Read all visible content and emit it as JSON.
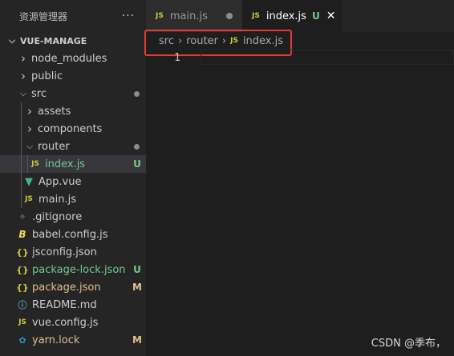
{
  "sidebar": {
    "title": "资源管理器",
    "more": "···",
    "project": "VUE-MANAGE",
    "items": [
      {
        "label": "node_modules",
        "kind": "folder",
        "expanded": false,
        "depth": 1
      },
      {
        "label": "public",
        "kind": "folder",
        "expanded": false,
        "depth": 1
      },
      {
        "label": "src",
        "kind": "folder",
        "expanded": true,
        "depth": 1,
        "status": "dot"
      },
      {
        "label": "assets",
        "kind": "folder",
        "expanded": false,
        "depth": 2
      },
      {
        "label": "components",
        "kind": "folder",
        "expanded": false,
        "depth": 2
      },
      {
        "label": "router",
        "kind": "folder",
        "expanded": true,
        "depth": 2,
        "status": "dot"
      },
      {
        "label": "index.js",
        "kind": "js",
        "depth": 3,
        "status": "U",
        "selected": true
      },
      {
        "label": "App.vue",
        "kind": "vue",
        "depth": 2
      },
      {
        "label": "main.js",
        "kind": "js",
        "depth": 2
      },
      {
        "label": ".gitignore",
        "kind": "git",
        "depth": 1
      },
      {
        "label": "babel.config.js",
        "kind": "babel",
        "depth": 1
      },
      {
        "label": "jsconfig.json",
        "kind": "json",
        "depth": 1
      },
      {
        "label": "package-lock.json",
        "kind": "json",
        "depth": 1,
        "status": "U"
      },
      {
        "label": "package.json",
        "kind": "json",
        "depth": 1,
        "status": "M"
      },
      {
        "label": "README.md",
        "kind": "info",
        "depth": 1
      },
      {
        "label": "vue.config.js",
        "kind": "js",
        "depth": 1
      },
      {
        "label": "yarn.lock",
        "kind": "yarn",
        "depth": 1,
        "status": "M"
      }
    ]
  },
  "tabs": [
    {
      "icon": "JS",
      "label": "main.js",
      "active": false,
      "modified": true
    },
    {
      "icon": "JS",
      "label": "index.js",
      "active": true,
      "status": "U",
      "close": "✕"
    }
  ],
  "breadcrumb": {
    "parts": [
      "src",
      "router"
    ],
    "file_icon": "JS",
    "file": "index.js"
  },
  "editor": {
    "line_numbers": [
      "1"
    ]
  },
  "watermark": "CSDN @季布，",
  "colors": {
    "accent_highlight": "#e53935",
    "untracked": "#73c991",
    "modified": "#e2c08d",
    "js_icon": "#cbcb41"
  }
}
